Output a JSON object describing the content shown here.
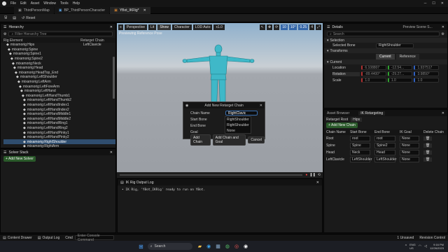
{
  "menu": {
    "items": [
      "File",
      "Edit",
      "Asset",
      "Window",
      "Tools",
      "Help"
    ]
  },
  "tabs": [
    {
      "label": "ThirdPersonMap"
    },
    {
      "label": "BP_ThirdPersonCharacter"
    },
    {
      "label": "YBot_IKRig*"
    }
  ],
  "toolbar": {
    "save_label": "",
    "reset_label": "Reset"
  },
  "hierarchy": {
    "title": "Hierarchy",
    "search_placeholder": "Filter Hierarchy Tree",
    "col_rig_element": "Rig Element",
    "col_retarget_chain": "Retarget Chain",
    "first_chain_value": "LeftClavicle",
    "rows": [
      "mixamorig:Hips",
      "mixamorig:Spine",
      "mixamorig:Spine1",
      "mixamorig:Spine2",
      "mixamorig:Neck",
      "mixamorig:Head",
      "mixamorig:HeadTop_End",
      "mixamorig:LeftShoulder",
      "mixamorig:LeftArm",
      "mixamorig:LeftForeArm",
      "mixamorig:LeftHand",
      "mixamorig:LeftHandThumb1",
      "mixamorig:LeftHandThumb2",
      "mixamorig:LeftHandIndex1",
      "mixamorig:LeftHandIndex2",
      "mixamorig:LeftHandMiddle1",
      "mixamorig:LeftHandMiddle2",
      "mixamorig:LeftHandRing1",
      "mixamorig:LeftHandRing2",
      "mixamorig:LeftHandPinky1",
      "mixamorig:LeftHandPinky2",
      "mixamorig:RightShoulder",
      "mixamorig:RightArm",
      "mixamorig:RightForeArm",
      "mixamorig:RightHand",
      "mixamorig:RightHandThumb1"
    ],
    "selected_index": 21
  },
  "solver_stack": {
    "title": "Solver Stack",
    "add_label": "+ Add New Solver"
  },
  "viewport": {
    "perspective": "Perspective",
    "lit": "Lit",
    "show": "Show",
    "character": "Character",
    "lod": "LOD Auto",
    "speed": "x1.0",
    "preview_label": "Previewing Reference Pose",
    "snap_values": [
      "10",
      "10°",
      "0.25",
      "4"
    ]
  },
  "dialog": {
    "title": "Add New Retarget Chain",
    "chain_name_label": "Chain Name",
    "start_bone_label": "Start Bone",
    "end_bone_label": "End Bone",
    "goal_label": "Goal",
    "chain_name_value": "RightClavic",
    "dropdown_options": [
      "RightShoulder",
      "RightShoulder",
      "None"
    ],
    "add_chain": "Add Chain",
    "add_chain_goal": "Add Chain and Goal",
    "cancel": "Cancel"
  },
  "output_log": {
    "title": "IK Rig Output Log",
    "line": "• IK Rig, 'YBot_IKRig' ready to run on YBot."
  },
  "details": {
    "title": "Details",
    "preview_tab": "Preview Scene S...",
    "search_placeholder": "Search",
    "selection_section": "Selection",
    "selected_bone_label": "Selected Bone",
    "selected_bone_value": "RightShoulder",
    "transforms_section": "Transforms",
    "current_label": "Current",
    "reference_label": "Reference",
    "current_section": "Current",
    "location_label": "Location",
    "rotation_label": "Rotation",
    "scale_label": "Scale",
    "location": [
      "6.108807",
      "-12.54...",
      "1.937517"
    ],
    "rotation": [
      "-89.4400°",
      "-29.27...",
      "3.9850°"
    ],
    "scale": [
      "1.0",
      "1.0",
      "1.0"
    ]
  },
  "asset_browser": {
    "tab_label": "Asset Browser",
    "retargeting_tab": "IK Retargeting",
    "retarget_root_label": "Retarget Root",
    "retarget_root_value": "Hips",
    "add_chain": "+ Add New Chain",
    "columns": [
      "Chain Name",
      "Start Bone",
      "End Bone",
      "IK Goal",
      "Delete Chain"
    ],
    "chains": [
      {
        "name": "Root",
        "start": "root",
        "end": "root",
        "goal": "None"
      },
      {
        "name": "Spine",
        "start": "Spine",
        "end": "Spine2",
        "goal": "None"
      },
      {
        "name": "Head",
        "start": "Neck",
        "end": "Head",
        "goal": "None"
      },
      {
        "name": "LeftClavicle",
        "start": "LeftShoulder",
        "end": "LeftShoulder",
        "goal": "None"
      }
    ]
  },
  "status": {
    "content_drawer": "Content Drawer",
    "output_log": "Output Log",
    "cmd": "Cmd",
    "cmd_placeholder": "Enter Console Command",
    "unsaved": "1 Unsaved",
    "source_control": "Revision Control"
  },
  "taskbar": {
    "search_placeholder": "Search",
    "lang": "ENG",
    "lang2": "US",
    "time": "9:16 PM",
    "date": "12/26/2023"
  },
  "colors": {
    "accent": "#2f4d6e",
    "green": "#2a5a2a",
    "mannequin": "#3fb8c8"
  }
}
